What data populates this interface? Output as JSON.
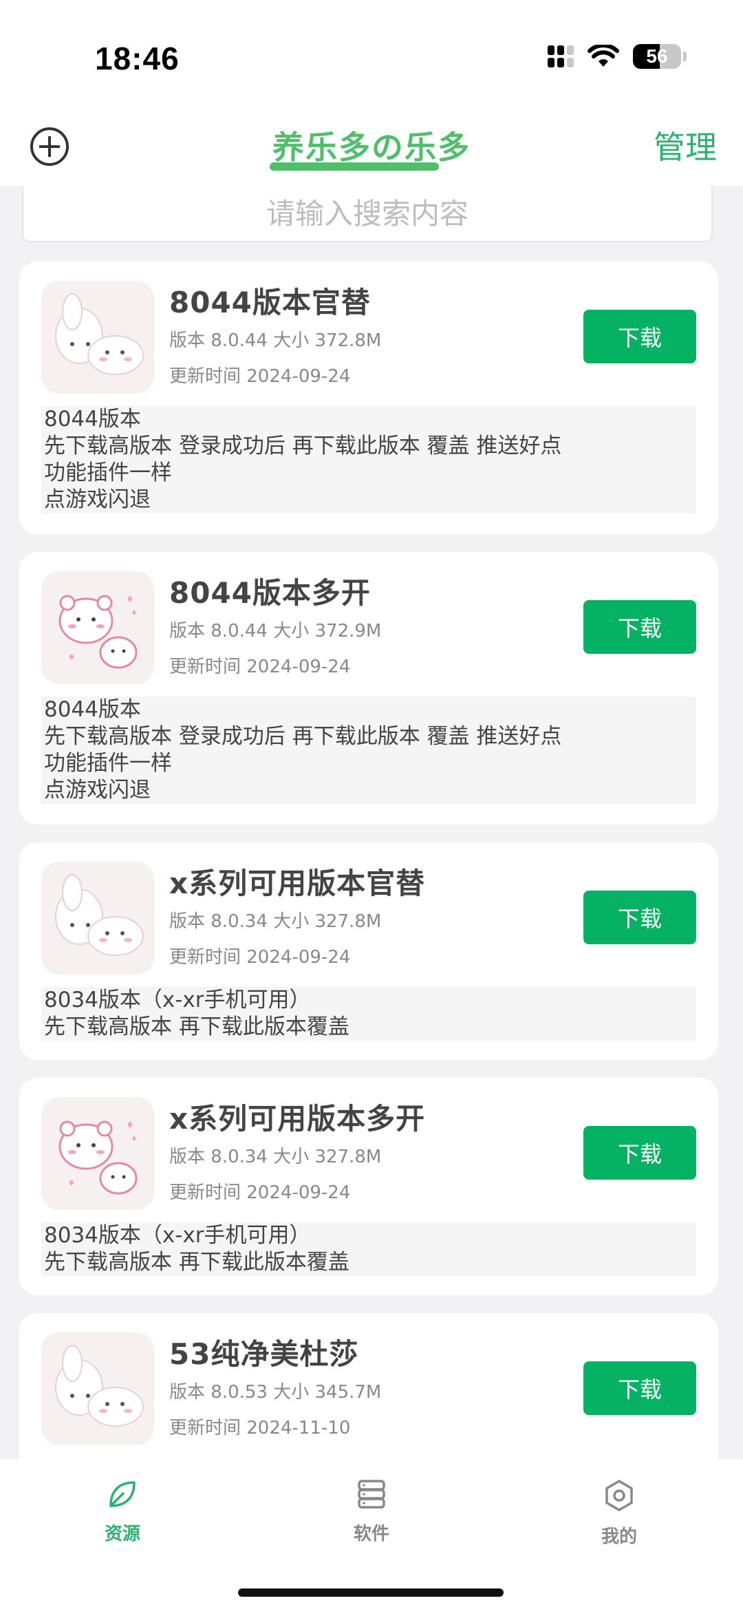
{
  "status_bar": {
    "time": "18:46",
    "battery": "56",
    "battery_level": 0.56
  },
  "header": {
    "title": "养乐多の乐多",
    "manage_label": "管理",
    "add_icon": "plus-circle-icon"
  },
  "search": {
    "placeholder": "请输入搜索内容",
    "value": ""
  },
  "download_label": "下载",
  "apps": [
    {
      "name": "8044版本官替",
      "meta": "版本 8.0.44 大小 372.8M",
      "date": "更新时间 2024-09-24",
      "icon": "bunny-sticker-icon",
      "desc": [
        "8044版本",
        "先下载高版本 登录成功后 再下载此版本 覆盖 推送好点",
        "功能插件一样",
        "点游戏闪退"
      ]
    },
    {
      "name": "8044版本多开",
      "meta": "版本 8.0.44 大小 372.9M",
      "date": "更新时间 2024-09-24",
      "icon": "bear-sticker-icon",
      "desc": [
        "8044版本",
        "先下载高版本 登录成功后 再下载此版本 覆盖 推送好点",
        "功能插件一样",
        "点游戏闪退"
      ]
    },
    {
      "name": "x系列可用版本官替",
      "meta": "版本 8.0.34 大小 327.8M",
      "date": "更新时间 2024-09-24",
      "icon": "bunny-sticker-icon",
      "desc": [
        "8034版本（x-xr手机可用）",
        "先下载高版本 再下载此版本覆盖"
      ]
    },
    {
      "name": "x系列可用版本多开",
      "meta": "版本 8.0.34 大小 327.8M",
      "date": "更新时间 2024-09-24",
      "icon": "bear-sticker-icon",
      "desc": [
        "8034版本（x-xr手机可用）",
        "先下载高版本 再下载此版本覆盖"
      ]
    },
    {
      "name": "53纯净美杜莎",
      "meta": "版本 8.0.53 大小 345.7M",
      "date": "更新时间 2024-11-10",
      "icon": "bunny-sticker-icon",
      "desc": []
    }
  ],
  "bottom_nav": [
    {
      "label": "资源",
      "icon": "leaf-icon",
      "active": true
    },
    {
      "label": "软件",
      "icon": "server-stack-icon",
      "active": false
    },
    {
      "label": "我的",
      "icon": "gear-icon",
      "active": false
    }
  ],
  "colors": {
    "accent": "#4fbf6b",
    "button": "#05b163",
    "nav_active": "#2bb26e"
  }
}
